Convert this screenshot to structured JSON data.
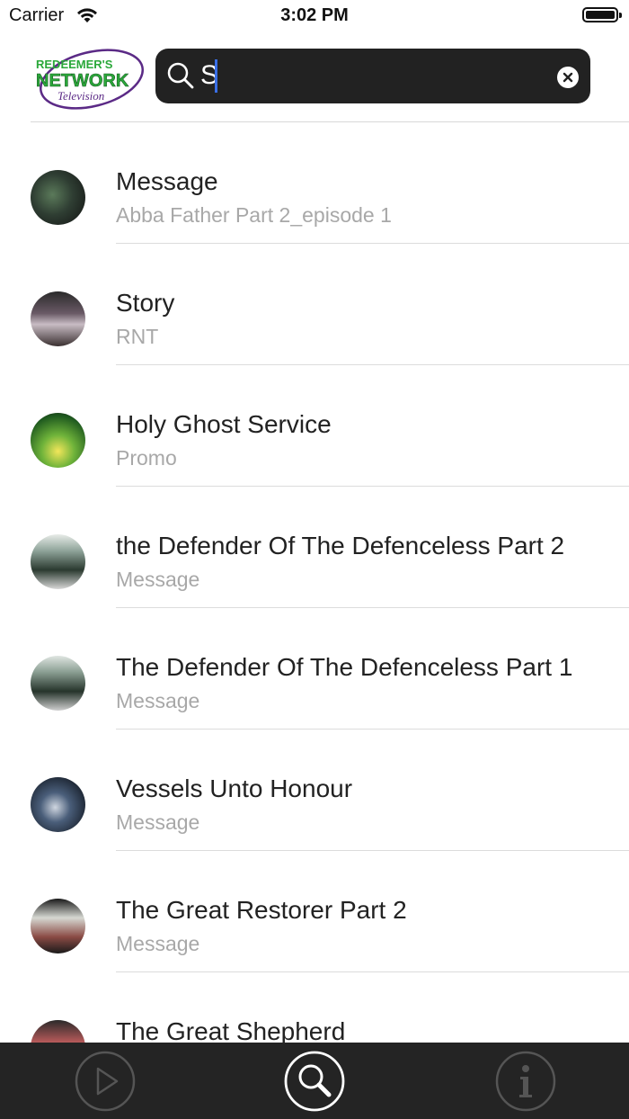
{
  "status_bar": {
    "carrier": "Carrier",
    "time": "3:02 PM"
  },
  "header": {
    "logo": {
      "line1": "REDEEMER'S",
      "line2": "NETWORK",
      "line3": "Television"
    },
    "search": {
      "value": "S",
      "placeholder": ""
    }
  },
  "list": {
    "items": [
      {
        "title": "Message",
        "subtitle": "Abba Father Part 2_episode 1"
      },
      {
        "title": "Story",
        "subtitle": "RNT"
      },
      {
        "title": "Holy Ghost Service",
        "subtitle": "Promo"
      },
      {
        "title": "the Defender Of The Defenceless Part 2",
        "subtitle": "Message"
      },
      {
        "title": "The Defender Of The Defenceless Part 1",
        "subtitle": "Message"
      },
      {
        "title": "Vessels Unto Honour",
        "subtitle": "Message"
      },
      {
        "title": "The Great Restorer Part 2",
        "subtitle": "Message"
      },
      {
        "title": "The Great Shepherd",
        "subtitle": ""
      }
    ]
  },
  "tabbar": {
    "tabs": [
      {
        "icon": "play-icon",
        "active": false
      },
      {
        "icon": "search-icon",
        "active": true
      },
      {
        "icon": "info-icon",
        "active": false
      }
    ]
  },
  "colors": {
    "search_bg": "#222222",
    "tabbar_bg": "#242424",
    "caret": "#3a6fe6",
    "logo_green": "#2aa83a",
    "logo_purple": "#5b2a86"
  }
}
